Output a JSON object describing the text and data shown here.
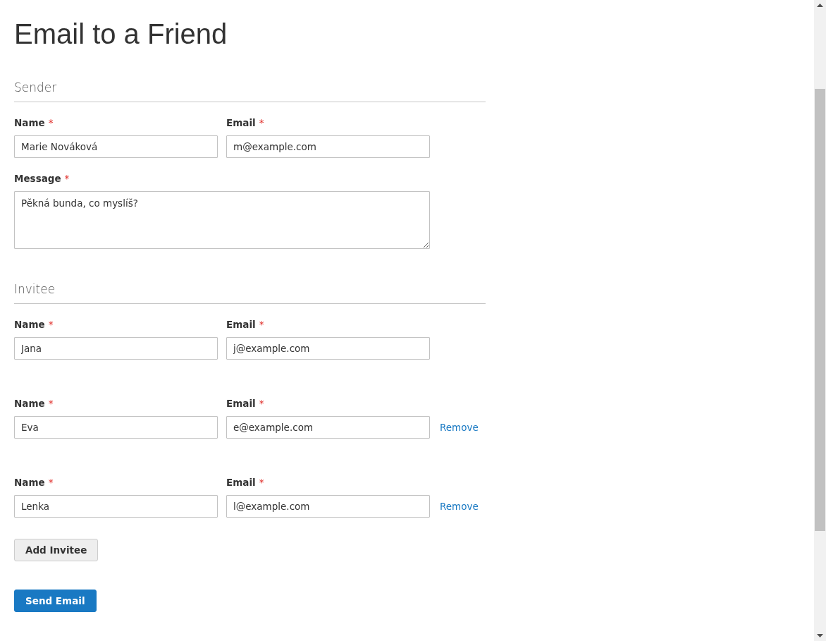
{
  "title": "Email to a Friend",
  "sender": {
    "heading": "Sender",
    "fields": [
      {
        "label": "Name",
        "required_mark": "*",
        "value": "Marie Nováková"
      },
      {
        "label": "Email",
        "required_mark": "*",
        "value": "m@example.com"
      }
    ],
    "message": {
      "label": "Message",
      "required_mark": "*",
      "value": "Pěkná bunda, co myslíš?"
    }
  },
  "invitee": {
    "heading": "Invitee",
    "rows": [
      {
        "name": {
          "label": "Name",
          "required_mark": "*",
          "value": "Jana"
        },
        "email": {
          "label": "Email",
          "required_mark": "*",
          "value": "j@example.com"
        }
      },
      {
        "name": {
          "label": "Name",
          "required_mark": "*",
          "value": "Eva"
        },
        "email": {
          "label": "Email",
          "required_mark": "*",
          "value": "e@example.com"
        },
        "remove_link": "Remove"
      },
      {
        "name": {
          "label": "Name",
          "required_mark": "*",
          "value": "Lenka"
        },
        "email": {
          "label": "Email",
          "required_mark": "*",
          "value": "l@example.com"
        },
        "remove_link": "Remove"
      }
    ],
    "add_button": "Add Invitee"
  },
  "submit_button": "Send Email"
}
